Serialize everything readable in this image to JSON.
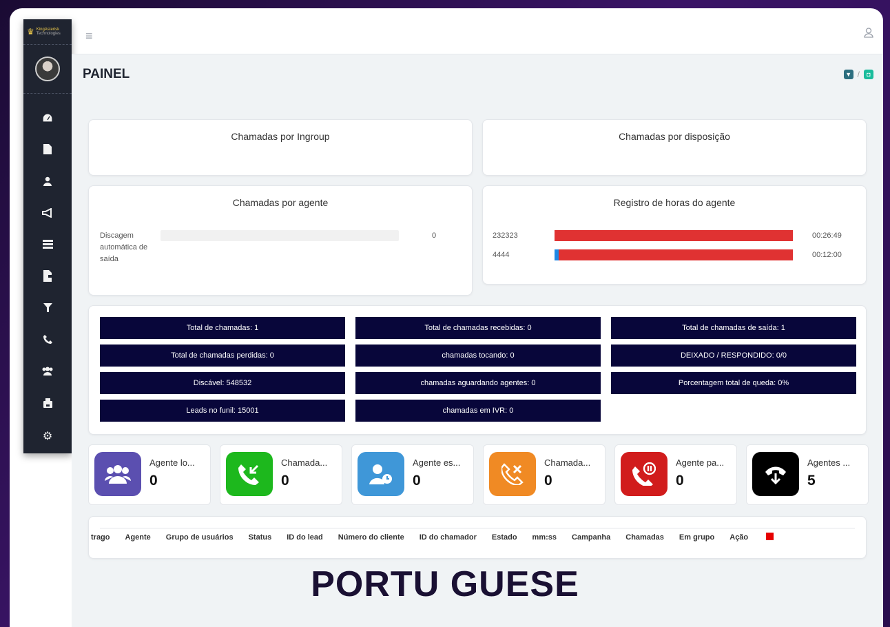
{
  "brand": {
    "name": "KingAsterisk",
    "sub": "Technologies"
  },
  "header": {
    "title": "PAINEL",
    "crumb_sep": "/"
  },
  "sidebar": {
    "items": [
      {
        "icon": "dashboard-icon",
        "glyph": "⏲"
      },
      {
        "icon": "file-icon",
        "glyph": "▰"
      },
      {
        "icon": "user-icon",
        "glyph": "●"
      },
      {
        "icon": "megaphone-icon",
        "glyph": "📣"
      },
      {
        "icon": "list-icon",
        "glyph": "☰"
      },
      {
        "icon": "document-icon",
        "glyph": "▮"
      },
      {
        "icon": "filter-icon",
        "glyph": "▼"
      },
      {
        "icon": "phone-icon",
        "glyph": "☎"
      },
      {
        "icon": "users-icon",
        "glyph": "👥"
      },
      {
        "icon": "printer-icon",
        "glyph": "⎙"
      },
      {
        "icon": "gear-icon",
        "glyph": "⚙"
      }
    ]
  },
  "cards": {
    "ingroup": "Chamadas por Ingroup",
    "disposition": "Chamadas por disposição",
    "agent": {
      "title": "Chamadas por agente",
      "rows": [
        {
          "label": "Discagem automática de saída",
          "value": "0"
        }
      ]
    },
    "hours": {
      "title": "Registro de horas do agente",
      "rows": [
        {
          "label": "232323",
          "time": "00:26:49"
        },
        {
          "label": "4444",
          "time": "00:12:00"
        }
      ]
    }
  },
  "stats": [
    "Total de chamadas: 1",
    "Total de chamadas recebidas: 0",
    "Total de chamadas de saída: 1",
    "Total de chamadas perdidas: 0",
    "chamadas tocando: 0",
    "DEIXADO / RESPONDIDO: 0/0",
    "Discável: 548532",
    "chamadas aguardando agentes: 0",
    "Porcentagem total de queda: 0%",
    "Leads no funil: 15001",
    "chamadas em IVR: 0"
  ],
  "agents": [
    {
      "label": "Agente lo...",
      "value": "0",
      "color": "#5b4fb0",
      "icon": "users-icon"
    },
    {
      "label": "Chamada...",
      "value": "0",
      "color": "#1db81d",
      "icon": "incoming-call-icon"
    },
    {
      "label": "Agente es...",
      "value": "0",
      "color": "#3f97d8",
      "icon": "user-clock-icon"
    },
    {
      "label": "Chamada...",
      "value": "0",
      "color": "#f08a24",
      "icon": "missed-call-icon"
    },
    {
      "label": "Agente pa...",
      "value": "0",
      "color": "#d11c1c",
      "icon": "paused-call-icon"
    },
    {
      "label": "Agentes ...",
      "value": "5",
      "color": "#000000",
      "icon": "hangup-icon"
    }
  ],
  "table": {
    "headers": [
      "trago",
      "Agente",
      "Grupo de usuários",
      "Status",
      "ID do lead",
      "Número do cliente",
      "ID do chamador",
      "Estado",
      "mm:ss",
      "Campanha",
      "Chamadas",
      "Em grupo",
      "Ação"
    ]
  },
  "footer": "PORTU GUESE"
}
